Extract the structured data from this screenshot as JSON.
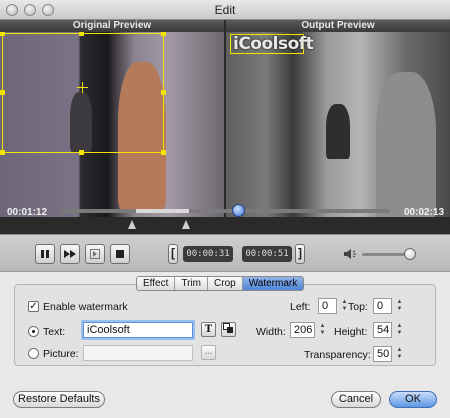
{
  "window": {
    "title": "Edit"
  },
  "preview": {
    "original_label": "Original Preview",
    "output_label": "Output Preview",
    "watermark_text": "iCoolsoft"
  },
  "timeline": {
    "current_time": "00:01:12",
    "total_time": "00:02:13",
    "playhead_fraction": 0.54,
    "selection_start_fraction": 0.23,
    "selection_end_fraction": 0.39
  },
  "transport": {
    "start_time": "00:00:31",
    "end_time": "00:00:51"
  },
  "tabs": [
    "Effect",
    "Trim",
    "Crop",
    "Watermark"
  ],
  "active_tab": "Watermark",
  "watermark": {
    "enable_label": "Enable watermark",
    "enabled": true,
    "text_label": "Text:",
    "text_value": "iCoolsoft",
    "picture_label": "Picture:",
    "picture_value": "",
    "browse_label": "...",
    "left_label": "Left:",
    "left_value": "0",
    "top_label": "Top:",
    "top_value": "0",
    "width_label": "Width:",
    "width_value": "206",
    "height_label": "Height:",
    "height_value": "54",
    "transparency_label": "Transparency:",
    "transparency_value": "50"
  },
  "buttons": {
    "restore": "Restore Defaults",
    "cancel": "Cancel",
    "ok": "OK"
  },
  "colors": {
    "crop_border": "#f0e400",
    "accent_blue": "#4f86d6"
  }
}
